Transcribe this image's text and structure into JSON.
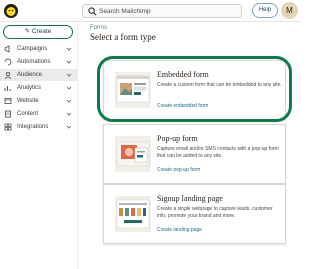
{
  "header": {
    "search_placeholder": "Search Mailchimp",
    "help_label": "Help",
    "avatar_initial": "M"
  },
  "sidebar": {
    "create_label": "Create",
    "items": [
      {
        "label": "Campaigns",
        "icon": "campaigns-icon"
      },
      {
        "label": "Automations",
        "icon": "automations-icon"
      },
      {
        "label": "Audience",
        "icon": "audience-icon",
        "active": true
      },
      {
        "label": "Analytics",
        "icon": "analytics-icon"
      },
      {
        "label": "Website",
        "icon": "website-icon"
      },
      {
        "label": "Content",
        "icon": "content-icon"
      },
      {
        "label": "Integrations",
        "icon": "integrations-icon"
      }
    ]
  },
  "main": {
    "breadcrumb": "Forms",
    "title": "Select a form type",
    "cards": [
      {
        "title": "Embedded form",
        "description": "Create a custom form that can be embedded to any site.",
        "link": "Create embedded form"
      },
      {
        "title": "Pop-up form",
        "description": "Capture email and/or SMS contacts with a pop-up form that can be added to any site.",
        "link": "Create pop-up form"
      },
      {
        "title": "Signup landing page",
        "description": "Create a single webpage to capture leads, customer info, promote your brand and more.",
        "link": "Create landing page"
      }
    ]
  },
  "colors": {
    "highlight": "#0f7a49",
    "brand_dark": "#241c15",
    "link": "#1f6b8a"
  }
}
